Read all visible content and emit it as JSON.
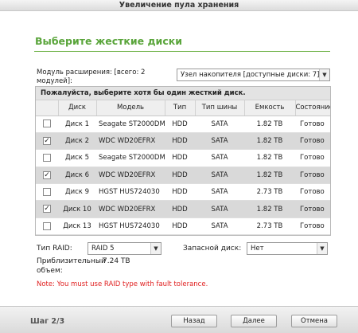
{
  "window": {
    "title": "Увеличение пула хранения"
  },
  "heading": "Выберите жесткие диски",
  "module": {
    "label": "Модуль расширения: [всего: 2 модулей]:",
    "selected": "Узел накопителя [доступные диски: 7]"
  },
  "table": {
    "message": "Пожалуйста, выберите хотя бы один жесткий диск.",
    "columns": [
      "",
      "Диск",
      "Модель",
      "Тип",
      "Тип шины",
      "Емкость",
      "Состояние"
    ],
    "rows": [
      {
        "checked": false,
        "disk": "Диск 1",
        "model": "Seagate ST2000DM001",
        "type": "HDD",
        "bus": "SATA",
        "capacity": "1.82 TB",
        "status": "Готово"
      },
      {
        "checked": true,
        "disk": "Диск 2",
        "model": "WDC WD20EFRX",
        "type": "HDD",
        "bus": "SATA",
        "capacity": "1.82 TB",
        "status": "Готово"
      },
      {
        "checked": false,
        "disk": "Диск 5",
        "model": "Seagate ST2000DM001",
        "type": "HDD",
        "bus": "SATA",
        "capacity": "1.82 TB",
        "status": "Готово"
      },
      {
        "checked": true,
        "disk": "Диск 6",
        "model": "WDC WD20EFRX",
        "type": "HDD",
        "bus": "SATA",
        "capacity": "1.82 TB",
        "status": "Готово"
      },
      {
        "checked": false,
        "disk": "Диск 9",
        "model": "HGST HUS724030",
        "type": "HDD",
        "bus": "SATA",
        "capacity": "2.73 TB",
        "status": "Готово"
      },
      {
        "checked": true,
        "disk": "Диск 10",
        "model": "WDC WD20EFRX",
        "type": "HDD",
        "bus": "SATA",
        "capacity": "1.82 TB",
        "status": "Готово"
      },
      {
        "checked": false,
        "disk": "Диск 13",
        "model": "HGST HUS724030",
        "type": "HDD",
        "bus": "SATA",
        "capacity": "2.73 TB",
        "status": "Готово"
      }
    ]
  },
  "raid": {
    "label": "Тип RAID:",
    "value": "RAID 5"
  },
  "spare": {
    "label": "Запасной диск:",
    "value": "Нет"
  },
  "approx": {
    "label": "Приблизительный объем:",
    "value": "7.24 TB"
  },
  "note": "Note: You must use RAID type with fault tolerance.",
  "footer": {
    "step": "Шаг 2/3",
    "back": "Назад",
    "next": "Далее",
    "cancel": "Отмена"
  },
  "icons": {
    "dropdown": "chevron-down-icon",
    "check": "checkmark-icon"
  }
}
